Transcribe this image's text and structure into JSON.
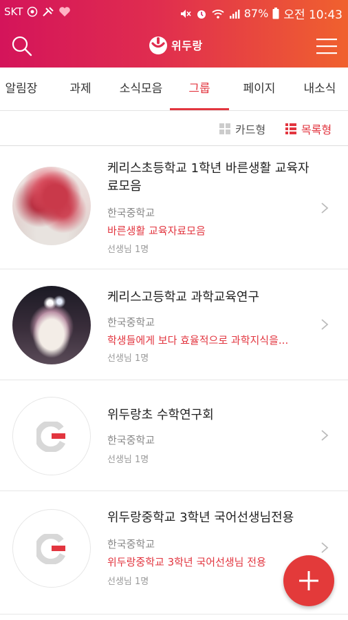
{
  "status_bar": {
    "carrier": "SKT",
    "battery": "87%",
    "time": "오전 10:43"
  },
  "app": {
    "logo_text": "위두랑"
  },
  "tabs": [
    {
      "label": "알림장"
    },
    {
      "label": "과제"
    },
    {
      "label": "소식모음"
    },
    {
      "label": "그룹",
      "active": true
    },
    {
      "label": "페이지"
    },
    {
      "label": "내소식"
    }
  ],
  "view_toggle": {
    "card_label": "카드형",
    "list_label": "목록형",
    "selected": "목록형"
  },
  "groups": [
    {
      "title": "케리스초등학교 1학년 바른생활 교육자료모음",
      "school": "한국중학교",
      "description": "바른생활 교육자료모음",
      "members": "선생님 1명",
      "avatar": "flower-photo"
    },
    {
      "title": "케리스고등학교 과학교육연구",
      "school": "한국중학교",
      "description": "학생들에게 보다 효율적으로 과학지식을...",
      "members": "선생님 1명",
      "avatar": "cake-photo"
    },
    {
      "title": "위두랑초 수학연구회",
      "school": "한국중학교",
      "description": "",
      "members": "선생님 1명",
      "avatar": "g-logo"
    },
    {
      "title": "위두랑중학교 3학년 국어선생님전용",
      "school": "한국중학교",
      "description": "위두랑중학교 3학년 국어선생님 전용",
      "members": "선생님 1명",
      "avatar": "g-logo"
    }
  ],
  "colors": {
    "accent": "#e2353f",
    "header_start": "#d4145a",
    "header_end": "#f0612e"
  }
}
